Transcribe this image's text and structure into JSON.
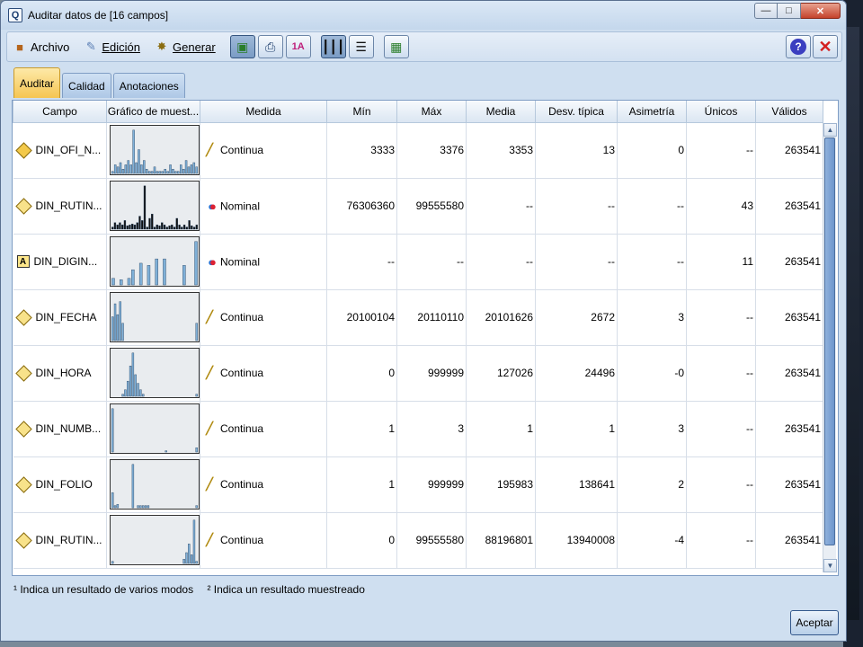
{
  "window": {
    "title": "Auditar datos de [16 campos]"
  },
  "menu": [
    {
      "label": "Archivo",
      "icon": "archive-icon"
    },
    {
      "label": "Edición",
      "icon": "edit-icon"
    },
    {
      "label": "Generar",
      "icon": "generate-icon"
    }
  ],
  "tabs": [
    "Auditar",
    "Calidad",
    "Anotaciones"
  ],
  "columns": [
    "Campo",
    "Gráfico de muest...",
    "Medida",
    "Mín",
    "Máx",
    "Media",
    "Desv. típica",
    "Asimetría",
    "Únicos",
    "Válidos"
  ],
  "rows": [
    {
      "field": "DIN_OFI_N...",
      "type_icon": "integer-field-icon",
      "measure": "Continua",
      "min": "3333",
      "max": "3376",
      "mean": "3353",
      "std": "13",
      "skew": "0",
      "unique": "--",
      "valid": "263541",
      "hist": [
        0.05,
        0.2,
        0.15,
        0.25,
        0.1,
        0.2,
        0.3,
        0.2,
        1.0,
        0.25,
        0.55,
        0.2,
        0.3,
        0.1,
        0.05,
        0.05,
        0.15,
        0.05,
        0.05,
        0.05,
        0.1,
        0.05,
        0.2,
        0.1,
        0.05,
        0.05,
        0.2,
        0.1,
        0.3,
        0.15,
        0.2,
        0.25,
        0.15
      ]
    },
    {
      "field": "DIN_RUTIN...",
      "type_icon": "set-field-icon",
      "measure": "Nominal",
      "min": "76306360",
      "max": "99555580",
      "mean": "--",
      "std": "--",
      "skew": "--",
      "unique": "43",
      "valid": "263541",
      "hist": [
        0.05,
        0.15,
        0.1,
        0.15,
        0.1,
        0.2,
        0.08,
        0.1,
        0.12,
        0.1,
        0.15,
        0.3,
        0.2,
        1.0,
        0.05,
        0.25,
        0.35,
        0.05,
        0.1,
        0.08,
        0.15,
        0.1,
        0.05,
        0.08,
        0.1,
        0.05,
        0.25,
        0.1,
        0.05,
        0.1,
        0.05,
        0.2,
        0.08,
        0.05,
        0.1
      ]
    },
    {
      "field": "DIN_DIGIN...",
      "type_icon": "string-field-icon",
      "measure": "Nominal",
      "min": "--",
      "max": "--",
      "mean": "--",
      "std": "--",
      "skew": "--",
      "unique": "11",
      "valid": "263541",
      "hist": [
        0.15,
        0,
        0.12,
        0,
        0.15,
        0.35,
        0,
        0.5,
        0,
        0.45,
        0,
        0.6,
        0,
        0.6,
        0,
        0,
        0,
        0,
        0.45,
        0,
        0,
        1.0
      ]
    },
    {
      "field": "DIN_FECHA",
      "type_icon": "date-field-icon",
      "measure": "Continua",
      "min": "20100104",
      "max": "20110110",
      "mean": "20101626",
      "std": "2672",
      "skew": "3",
      "unique": "--",
      "valid": "263541",
      "hist": [
        0.55,
        0.85,
        0.6,
        0.9,
        0.4,
        0,
        0,
        0,
        0,
        0,
        0,
        0,
        0,
        0,
        0,
        0,
        0,
        0,
        0,
        0,
        0,
        0,
        0,
        0,
        0,
        0,
        0,
        0,
        0,
        0,
        0,
        0,
        0,
        0.4
      ]
    },
    {
      "field": "DIN_HORA",
      "type_icon": "date-field-icon",
      "measure": "Continua",
      "min": "0",
      "max": "999999",
      "mean": "127026",
      "std": "24496",
      "skew": "-0",
      "unique": "--",
      "valid": "263541",
      "hist": [
        0,
        0,
        0,
        0,
        0.05,
        0.15,
        0.35,
        0.7,
        1.0,
        0.5,
        0.3,
        0.15,
        0.05,
        0,
        0,
        0,
        0,
        0,
        0,
        0,
        0,
        0,
        0,
        0,
        0,
        0,
        0,
        0,
        0,
        0,
        0,
        0,
        0,
        0.05
      ]
    },
    {
      "field": "DIN_NUMB...",
      "type_icon": "date-field-icon",
      "measure": "Continua",
      "min": "1",
      "max": "3",
      "mean": "1",
      "std": "1",
      "skew": "3",
      "unique": "--",
      "valid": "263541",
      "hist": [
        1.0,
        0,
        0,
        0,
        0,
        0,
        0,
        0,
        0,
        0,
        0,
        0,
        0,
        0,
        0,
        0,
        0,
        0,
        0,
        0,
        0,
        0.03,
        0,
        0,
        0,
        0,
        0,
        0,
        0,
        0,
        0,
        0,
        0,
        0.1
      ]
    },
    {
      "field": "DIN_FOLIO",
      "type_icon": "date-field-icon",
      "measure": "Continua",
      "min": "1",
      "max": "999999",
      "mean": "195983",
      "std": "138641",
      "skew": "2",
      "unique": "--",
      "valid": "263541",
      "hist": [
        0.35,
        0.05,
        0.08,
        0,
        0,
        0,
        0,
        0,
        1.0,
        0,
        0.05,
        0.05,
        0.05,
        0.05,
        0.05,
        0,
        0,
        0,
        0,
        0,
        0,
        0,
        0,
        0,
        0,
        0,
        0,
        0,
        0,
        0,
        0,
        0,
        0,
        0.05
      ]
    },
    {
      "field": "DIN_RUTIN...",
      "type_icon": "date-field-icon",
      "measure": "Continua",
      "min": "0",
      "max": "99555580",
      "mean": "88196801",
      "std": "13940008",
      "skew": "-4",
      "unique": "--",
      "valid": "263541",
      "hist": [
        0.05,
        0,
        0,
        0,
        0,
        0,
        0,
        0,
        0,
        0,
        0,
        0,
        0,
        0,
        0,
        0,
        0,
        0,
        0,
        0,
        0,
        0,
        0,
        0,
        0,
        0,
        0,
        0,
        0.1,
        0.25,
        0.45,
        0.2,
        1.0,
        0.05
      ]
    }
  ],
  "measure_icons": {
    "Continua": "ruler-icon",
    "Nominal": "nominal-balls-icon"
  },
  "footnotes": [
    "¹ Indica un resultado de varios modos",
    "² Indica un resultado muestreado"
  ],
  "accept_label": "Aceptar",
  "colors": {
    "bar": "#7fb0d8",
    "tab_active": "#f5c552",
    "panel_bg": "#cfdff0"
  }
}
